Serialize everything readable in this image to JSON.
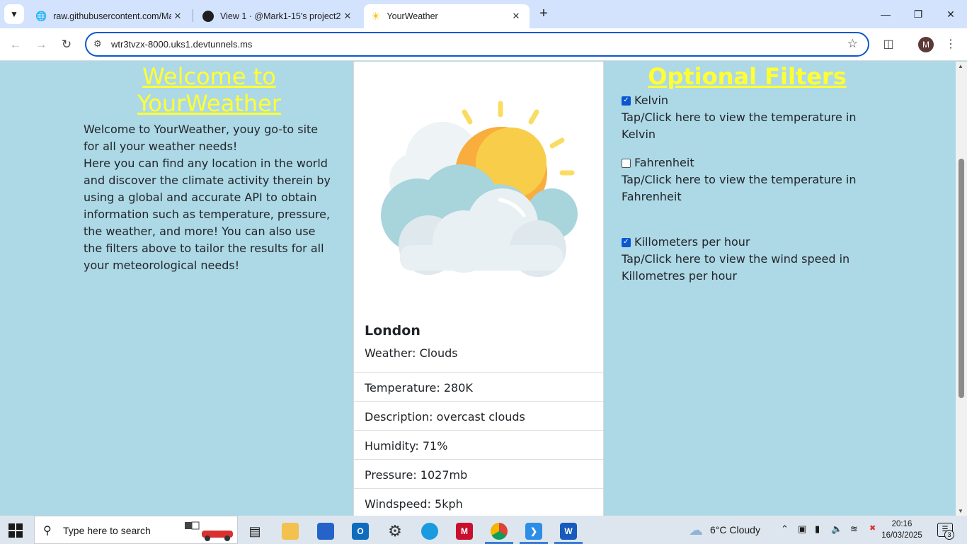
{
  "browser": {
    "tabs": [
      {
        "title": "raw.githubusercontent.com/Ma",
        "icon": "globe-icon"
      },
      {
        "title": "View 1 · @Mark1-15's project2",
        "icon": "github-icon"
      },
      {
        "title": "YourWeather",
        "icon": "sun-icon"
      }
    ],
    "active_tab": 2,
    "address": "wtr3tvzx-8000.uks1.devtunnels.ms",
    "profile_initial": "M",
    "accent_color": "#0b57d0"
  },
  "page": {
    "left": {
      "title": "Welcome to YourWeather",
      "intro_line1": "Welcome to YourWeather, youy go-to site for all your weather needs!",
      "intro_line2": "Here you can find any location in the world and discover the climate activity therein by using a global and accurate API to obtain information such as temperature, pressure, the weather, and more! You can also use the filters above to tailor the results for all your meteorological needs!",
      "title_color": "#ffff33"
    },
    "card": {
      "image_icon": "sun-behind-cloud-icon",
      "city": "London",
      "weather": "Weather: Clouds",
      "rows": [
        "Temperature: 280K",
        "Description: overcast clouds",
        "Humidity: 71%",
        "Pressure: 1027mb",
        "Windspeed: 5kph"
      ]
    },
    "filters": {
      "title": "Optional Filters",
      "items": [
        {
          "label": "Kelvin",
          "checked": true,
          "help": "Tap/Click here to view the temperature in Kelvin"
        },
        {
          "label": "Fahrenheit",
          "checked": false,
          "help": "Tap/Click here to view the temperature in Fahrenheit"
        },
        {
          "label": "Killometers per hour",
          "checked": true,
          "help": "Tap/Click here to view the wind speed in Killometres per hour"
        }
      ]
    },
    "background_color": "#add8e6"
  },
  "taskbar": {
    "search_placeholder": "Type here to search",
    "weather": "6°C  Cloudy",
    "time": "20:16",
    "date": "16/03/2025",
    "notification_count": "3"
  }
}
